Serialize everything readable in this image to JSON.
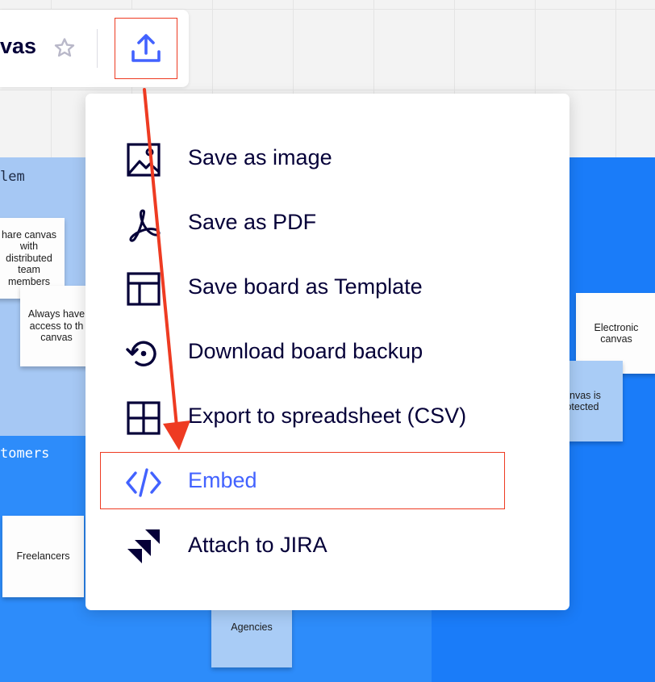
{
  "board": {
    "title": "vas",
    "frames": {
      "problem_title": "lem",
      "customers_title": "tomers"
    },
    "stickies": [
      {
        "id": "share",
        "text": "hare canvas\nwith\ndistributed\nteam\nmembers"
      },
      {
        "id": "access",
        "text": "Always have\naccess to th\ncanvas"
      },
      {
        "id": "electronic",
        "text": "Electronic\ncanvas"
      },
      {
        "id": "protected",
        "text": "anvas is\notected"
      },
      {
        "id": "freelancers",
        "text": "Freelancers"
      },
      {
        "id": "agencies",
        "text": "Agencies"
      }
    ]
  },
  "toolbar": {
    "star_icon": "star-outline-icon",
    "export_icon": "upload-icon",
    "accent": "#4262ff",
    "highlight": "#ee3b22"
  },
  "export_menu": {
    "items": [
      {
        "label": "Save as image",
        "icon": "image-icon"
      },
      {
        "label": "Save as PDF",
        "icon": "pdf-icon"
      },
      {
        "label": "Save board as Template",
        "icon": "template-icon"
      },
      {
        "label": "Download board backup",
        "icon": "backup-restore-icon"
      },
      {
        "label": "Export to spreadsheet (CSV)",
        "icon": "grid-icon"
      },
      {
        "label": "Embed",
        "icon": "code-icon"
      },
      {
        "label": "Attach to JIRA",
        "icon": "jira-icon"
      }
    ],
    "highlighted_item": "Embed"
  }
}
